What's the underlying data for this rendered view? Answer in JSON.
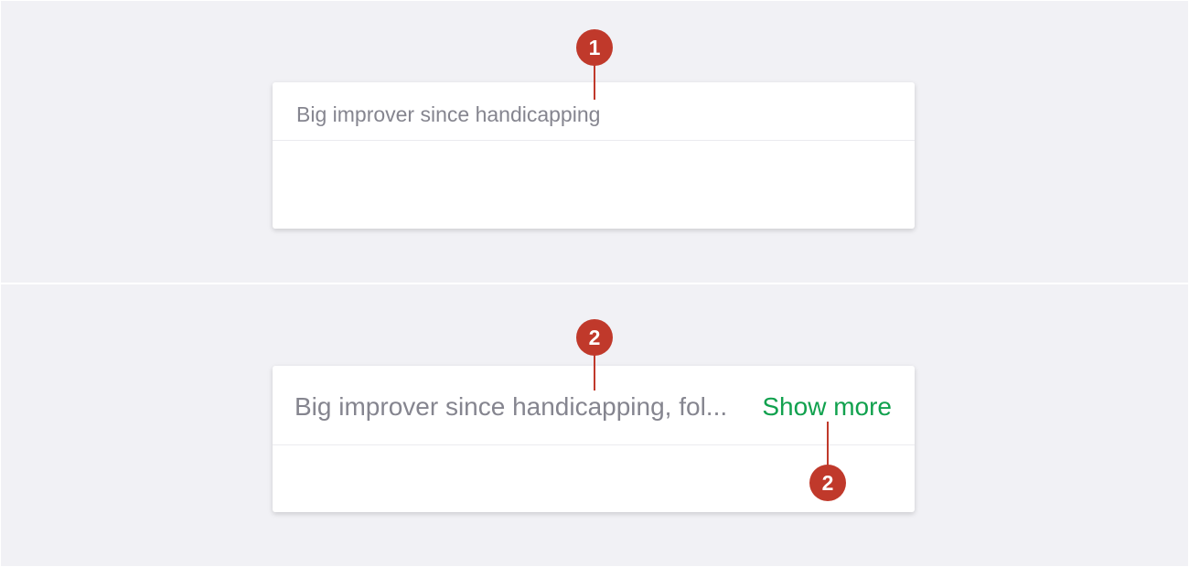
{
  "examples": [
    {
      "title_text": "Big improver since handicapping",
      "marker": "1"
    },
    {
      "title_text": "Big improver since handicapping, fol...",
      "show_more_label": "Show more",
      "marker_text": "2",
      "marker_link": "2"
    }
  ],
  "colors": {
    "marker": "#c0392b",
    "link": "#11a14e",
    "text": "#85858f",
    "background": "#f1f1f5"
  }
}
